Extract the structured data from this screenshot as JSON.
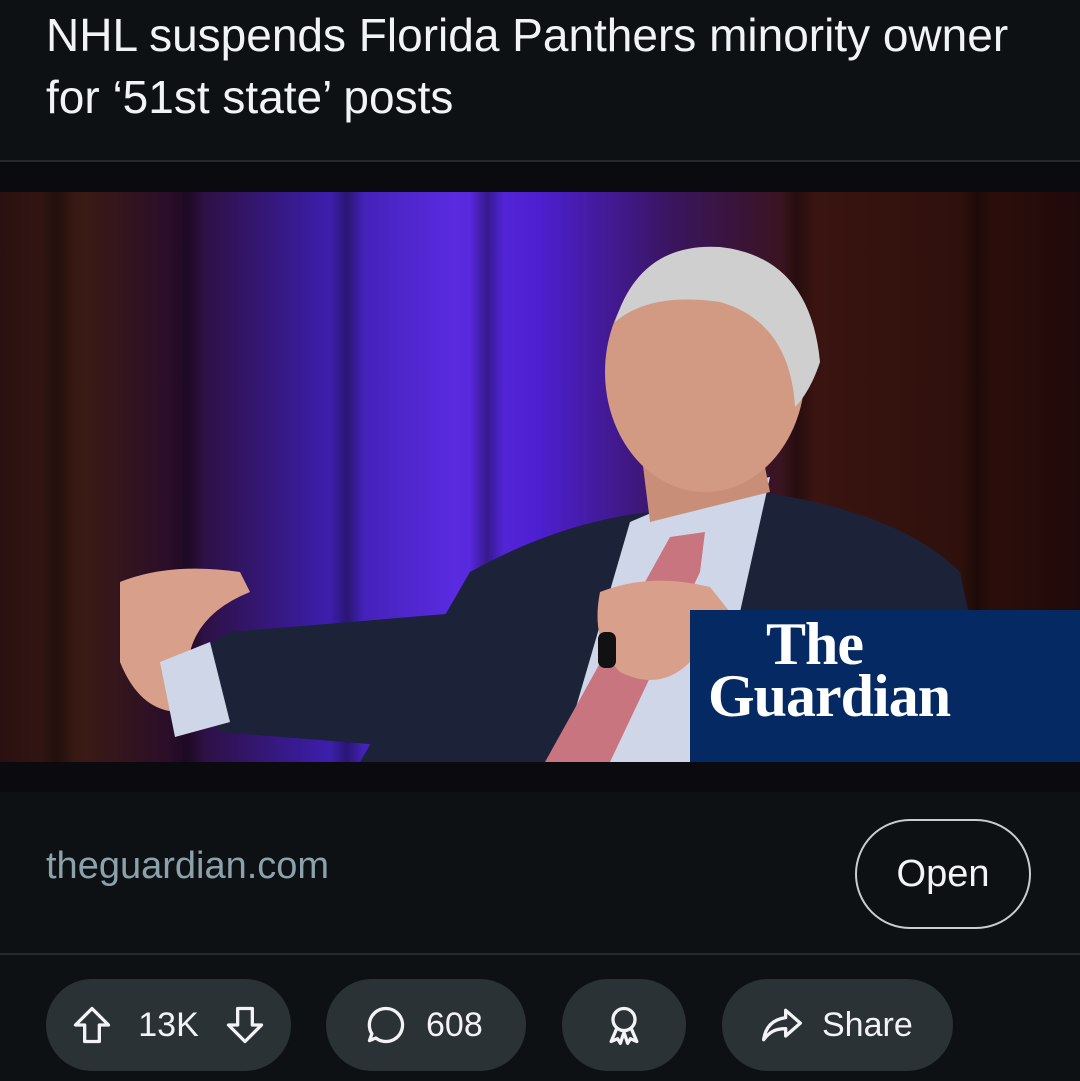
{
  "post": {
    "title": "NHL suspends Florida Panthers minority owner for ‘51st state’ posts"
  },
  "media": {
    "logo_line1": "The",
    "logo_line2": "Guardian",
    "brand_color": "#052962"
  },
  "link": {
    "domain": "theguardian.com",
    "open_label": "Open"
  },
  "actions": {
    "vote_count": "13K",
    "comment_count": "608",
    "share_label": "Share",
    "icons": [
      "upvote-icon",
      "downvote-icon",
      "comment-icon",
      "award-icon",
      "share-icon"
    ]
  }
}
